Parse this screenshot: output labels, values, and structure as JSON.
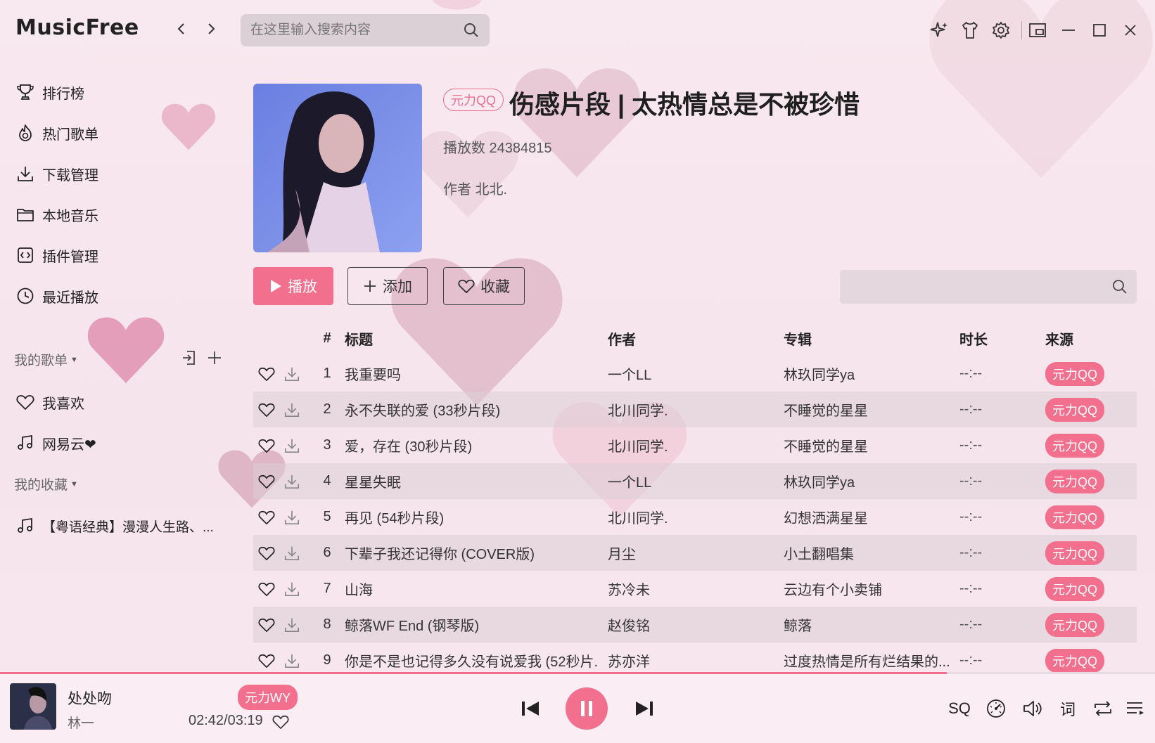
{
  "app": {
    "logo": "MusicFree",
    "search_placeholder": "在这里输入搜索内容"
  },
  "sidebar": {
    "items": [
      {
        "label": "排行榜",
        "icon": "trophy-icon"
      },
      {
        "label": "热门歌单",
        "icon": "flame-icon"
      },
      {
        "label": "下载管理",
        "icon": "download-icon"
      },
      {
        "label": "本地音乐",
        "icon": "folder-icon"
      },
      {
        "label": "插件管理",
        "icon": "code-icon"
      },
      {
        "label": "最近播放",
        "icon": "clock-icon"
      }
    ],
    "my_playlists_label": "我的歌单",
    "my_playlists": [
      {
        "label": "我喜欢",
        "icon": "heart-icon"
      },
      {
        "label": "网易云❤",
        "icon": "music-note-icon"
      }
    ],
    "my_collections_label": "我的收藏",
    "my_collections": [
      {
        "label": "【粤语经典】漫漫人生路、...",
        "icon": "music-note-icon"
      }
    ]
  },
  "playlist": {
    "source_tag": "元力QQ",
    "title": "伤感片段 | 太热情总是不被珍惜",
    "play_count": "播放数 24384815",
    "author": "作者 北北.",
    "play_label": "播放",
    "add_label": "添加",
    "collect_label": "收藏"
  },
  "table": {
    "headers": {
      "num": "#",
      "title": "标题",
      "artist": "作者",
      "album": "专辑",
      "duration": "时长",
      "source": "来源"
    },
    "rows": [
      {
        "num": "1",
        "title": "我重要吗",
        "artist": "一个LL",
        "album": "林玖同学ya",
        "duration": "--:--",
        "source": "元力QQ"
      },
      {
        "num": "2",
        "title": "永不失联的爱 (33秒片段)",
        "artist": "北川同学.",
        "album": "不睡觉的星星",
        "duration": "--:--",
        "source": "元力QQ"
      },
      {
        "num": "3",
        "title": "爱，存在 (30秒片段)",
        "artist": "北川同学.",
        "album": "不睡觉的星星",
        "duration": "--:--",
        "source": "元力QQ"
      },
      {
        "num": "4",
        "title": "星星失眠",
        "artist": "一个LL",
        "album": "林玖同学ya",
        "duration": "--:--",
        "source": "元力QQ"
      },
      {
        "num": "5",
        "title": "再见 (54秒片段)",
        "artist": "北川同学.",
        "album": "幻想洒满星星",
        "duration": "--:--",
        "source": "元力QQ"
      },
      {
        "num": "6",
        "title": "下辈子我还记得你 (COVER版)",
        "artist": "月尘",
        "album": "小土翻唱集",
        "duration": "--:--",
        "source": "元力QQ"
      },
      {
        "num": "7",
        "title": "山海",
        "artist": "苏冷未",
        "album": "云边有个小卖铺",
        "duration": "--:--",
        "source": "元力QQ"
      },
      {
        "num": "8",
        "title": "鲸落WF End (钢琴版)",
        "artist": "赵俊铭",
        "album": "鲸落",
        "duration": "--:--",
        "source": "元力QQ"
      },
      {
        "num": "9",
        "title": "你是不是也记得多久没有说爱我 (52秒片...",
        "artist": "苏亦洋",
        "album": "过度热情是所有烂结果的...",
        "duration": "--:--",
        "source": "元力QQ"
      }
    ]
  },
  "player": {
    "title": "处处吻",
    "artist": "林一",
    "source": "元力WY",
    "time": "02:42/03:19",
    "progress": 0.82,
    "quality_label": "SQ",
    "lyrics_label": "词"
  },
  "colors": {
    "accent": "#f26f8d",
    "background": "#f7e9ef"
  }
}
